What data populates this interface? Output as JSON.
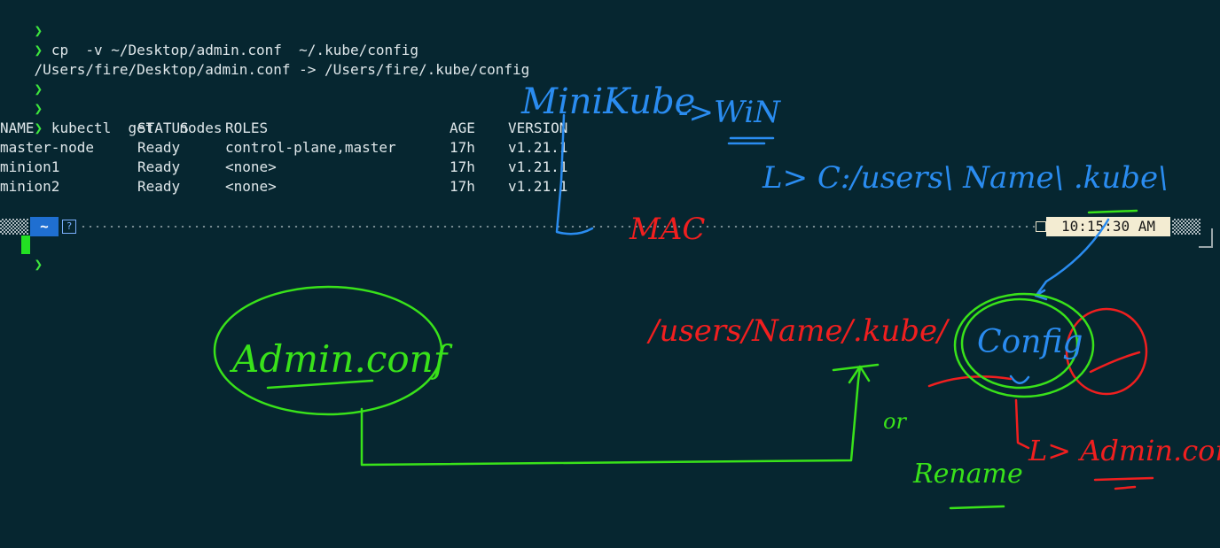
{
  "terminal": {
    "prompt_glyph": "❯",
    "lines": [
      {
        "type": "prompt",
        "text": ""
      },
      {
        "type": "prompt",
        "text": "cp  -v ~/Desktop/admin.conf  ~/.kube/config"
      },
      {
        "type": "output",
        "text": "/Users/fire/Desktop/admin.conf -> /Users/fire/.kube/config"
      },
      {
        "type": "prompt",
        "text": ""
      },
      {
        "type": "prompt",
        "text": ""
      },
      {
        "type": "prompt",
        "text": "kubectl  get   nodes"
      }
    ],
    "table": {
      "headers": [
        "NAME",
        "STATUS",
        "ROLES",
        "AGE",
        "VERSION"
      ],
      "rows": [
        [
          "master-node",
          "Ready",
          "control-plane,master",
          "17h",
          "v1.21.1"
        ],
        [
          "minion1",
          "Ready",
          "<none>",
          "17h",
          "v1.21.1"
        ],
        [
          "minion2",
          "Ready",
          "<none>",
          "17h",
          "v1.21.1"
        ]
      ]
    },
    "statusbar": {
      "home_label": "~",
      "help_icon": "?",
      "time": "10:15:30 AM"
    },
    "colors": {
      "background": "#062630",
      "prompt": "#3ee63e",
      "text": "#dfe7ea",
      "home_segment": "#1f6fd1",
      "time_segment": "#f3ecd2"
    }
  },
  "annotations": {
    "ink_colors": {
      "blue": "#2a8cf0",
      "red": "#f01f1f",
      "green": "#39e21a"
    },
    "handwriting": {
      "minikube": "MiniKube",
      "arrow_win": "->WiN",
      "win_path": "L> C:/users\\ Name\\ .kube\\",
      "mac": "MAC",
      "adminconf_left": "Admin.conf",
      "mac_path": "/users/Name/.kube/",
      "or": "or",
      "config": "Config",
      "rename": "Rename",
      "adminconf_right": "L> Admin.conf"
    }
  }
}
